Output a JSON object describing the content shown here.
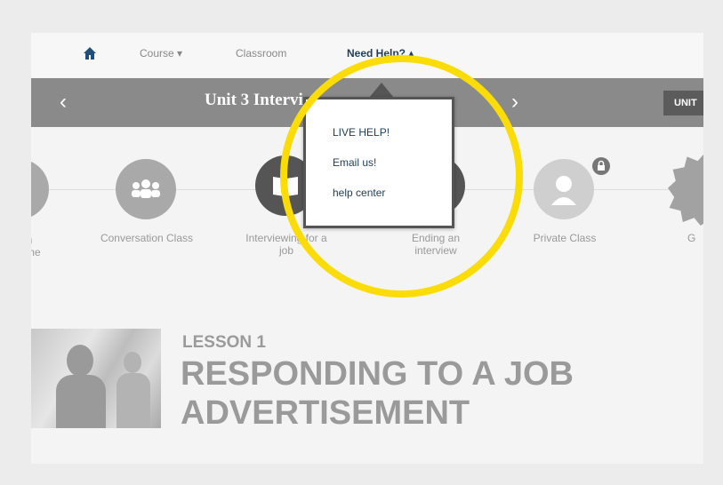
{
  "nav": {
    "home_icon": "home-icon",
    "course_label": "Course ▾",
    "classroom_label": "Classroom",
    "help_label": "Need Help? ▴"
  },
  "unit_bar": {
    "title": "Unit 3  Intervi",
    "prev_arrow": "‹",
    "next_arrow": "›",
    "unit_button": "UNIT"
  },
  "help_menu": {
    "items": [
      "LIVE HELP!",
      "Email us!",
      "help center"
    ]
  },
  "timeline": {
    "partial_left_label": "an\ntime",
    "items": [
      {
        "label": "Conversation Class",
        "icon": "group-icon"
      },
      {
        "label": "Interviewing for a\njob",
        "icon": "book-icon"
      },
      {
        "label": "Ending an\ninterview",
        "icon": "handshake-icon"
      },
      {
        "label": "Private Class",
        "icon": "person-icon",
        "locked": true
      },
      {
        "label": "G",
        "icon": "badge-icon"
      }
    ]
  },
  "lesson": {
    "number_label": "LESSON 1",
    "title": "RESPONDING TO A JOB ADVERTISEMENT"
  },
  "colors": {
    "highlight": "#fbdc06",
    "nav_active": "#1f3d5a",
    "unit_bar": "#8a8a8a",
    "dropdown_border": "#555555"
  }
}
